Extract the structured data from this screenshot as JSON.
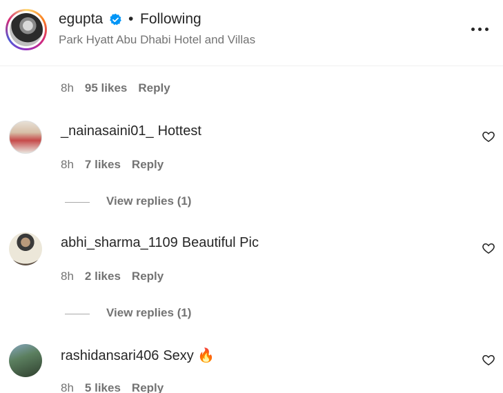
{
  "header": {
    "username": "egupta",
    "separator": "•",
    "follow_status": "Following",
    "location": "Park Hyatt Abu Dhabi Hotel and Villas",
    "more_icon": "more-horizontal-icon"
  },
  "first_meta": {
    "time": "8h",
    "likes": "95 likes",
    "reply": "Reply"
  },
  "comments": [
    {
      "username": "_nainasaini01_",
      "text": "Hottest",
      "time": "8h",
      "likes": "7 likes",
      "reply": "Reply",
      "view_replies": "View replies (1)"
    },
    {
      "username": "abhi_sharma_1109",
      "text": "Beautiful Pic",
      "time": "8h",
      "likes": "2 likes",
      "reply": "Reply",
      "view_replies": "View replies (1)"
    },
    {
      "username": "rashidansari406",
      "text": "Sexy 🔥",
      "time": "8h",
      "likes": "5 likes",
      "reply": "Reply"
    }
  ],
  "colors": {
    "text": "#262626",
    "secondary": "#737373",
    "verified": "#0095f6"
  }
}
